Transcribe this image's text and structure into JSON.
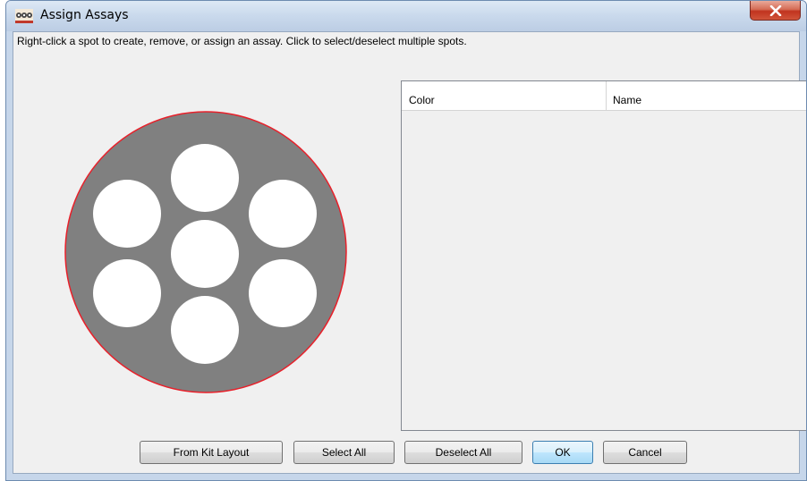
{
  "window": {
    "title": "Assign Assays",
    "close_label": "X"
  },
  "instruction": "Right-click a spot to create, remove, or assign an assay.  Click to select/deselect multiple spots.",
  "table": {
    "columns": [
      "Color",
      "Name"
    ],
    "rows": []
  },
  "spot_map": {
    "plate_color": "#808080",
    "plate_outline_color": "#e8202a",
    "spot_color": "#ffffff",
    "spot_count": 7
  },
  "buttons": {
    "from_kit_layout": "From Kit Layout",
    "select_all": "Select All",
    "deselect_all": "Deselect All",
    "ok": "OK",
    "cancel": "Cancel"
  }
}
